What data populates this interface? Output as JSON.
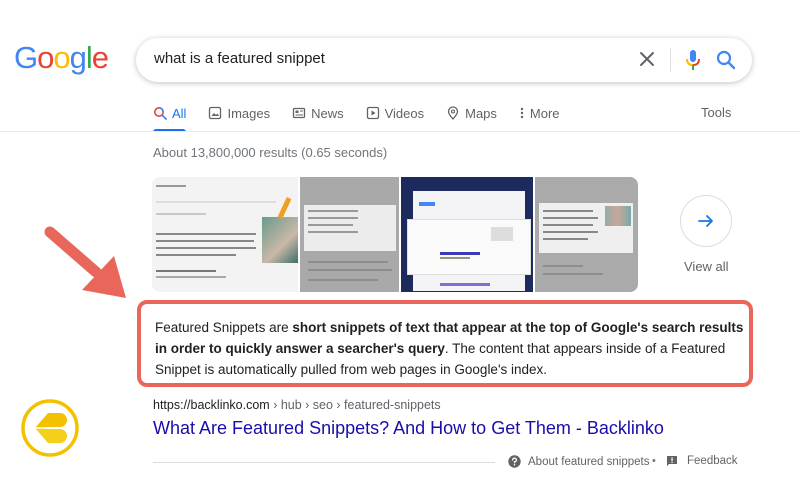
{
  "logo": {
    "letters": [
      "G",
      "o",
      "o",
      "g",
      "l",
      "e"
    ],
    "colors": [
      "#4285f4",
      "#ea4335",
      "#fbbc05",
      "#4285f4",
      "#34a853",
      "#ea4335"
    ]
  },
  "search": {
    "query": "what is a featured snippet",
    "clear_icon": "close-icon",
    "voice_icon": "mic-icon",
    "search_icon": "search-icon"
  },
  "tabs": [
    {
      "label": "All",
      "icon": "search-icon",
      "active": true
    },
    {
      "label": "Images",
      "icon": "image-icon",
      "active": false
    },
    {
      "label": "News",
      "icon": "news-icon",
      "active": false
    },
    {
      "label": "Videos",
      "icon": "play-icon",
      "active": false
    },
    {
      "label": "Maps",
      "icon": "map-pin-icon",
      "active": false
    },
    {
      "label": "More",
      "icon": "more-vert-icon",
      "active": false
    }
  ],
  "tools_label": "Tools",
  "result_stats": "About 13,800,000 results (0.65 seconds)",
  "image_strip": {
    "view_all_label": "View all",
    "view_all_icon": "arrow-right-icon"
  },
  "featured_snippet": {
    "text_before": "Featured Snippets are ",
    "text_bold": "short snippets of text that appear at the top of Google's search results in order to quickly answer a searcher's query",
    "text_after": ". The content that appears inside of a Featured Snippet is automatically pulled from web pages in Google's index.",
    "highlight_color": "#e8675a"
  },
  "result": {
    "cite_domain": "https://backlinko.com",
    "cite_path": " › hub › seo › featured-snippets",
    "title": "What Are Featured Snippets? And How to Get Them - Backlinko",
    "title_color": "#1a0dab"
  },
  "footer": {
    "about_label": "About featured snippets",
    "separator": "•",
    "feedback_label": "Feedback"
  },
  "colors": {
    "accent": "#1a73e8",
    "annotation": "#e8675a",
    "brand_yellow": "#f2c200"
  }
}
